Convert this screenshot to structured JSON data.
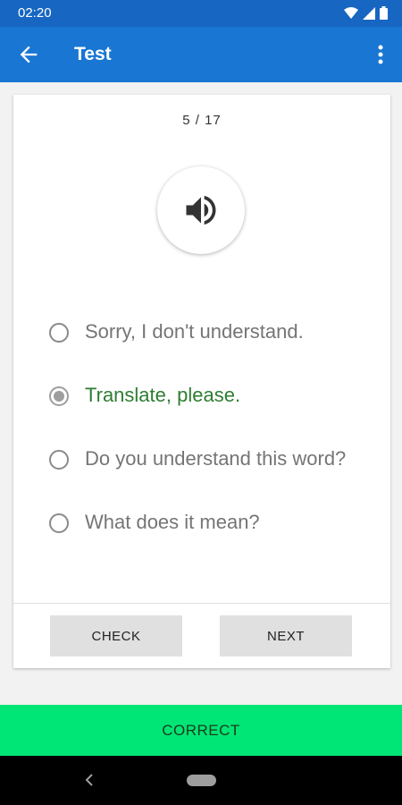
{
  "status_bar": {
    "time": "02:20",
    "icons": [
      "wifi-icon",
      "signal-icon",
      "battery-icon"
    ]
  },
  "app_bar": {
    "title": "Test",
    "back_icon": "arrow-back-icon",
    "menu_icon": "more-vertical-icon"
  },
  "quiz": {
    "progress": "5 / 17",
    "audio_icon": "speaker-icon",
    "options": [
      {
        "label": "Sorry, I don't understand.",
        "selected": false,
        "correct": false
      },
      {
        "label": "Translate, please.",
        "selected": true,
        "correct": true
      },
      {
        "label": "Do you understand this word?",
        "selected": false,
        "correct": false
      },
      {
        "label": "What does it mean?",
        "selected": false,
        "correct": false
      }
    ],
    "check_label": "CHECK",
    "next_label": "NEXT"
  },
  "result": {
    "label": "CORRECT",
    "color": "#00e676"
  },
  "colors": {
    "primary": "#1976d2",
    "status_bar": "#1666c2",
    "correct_text": "#2e7d32"
  }
}
